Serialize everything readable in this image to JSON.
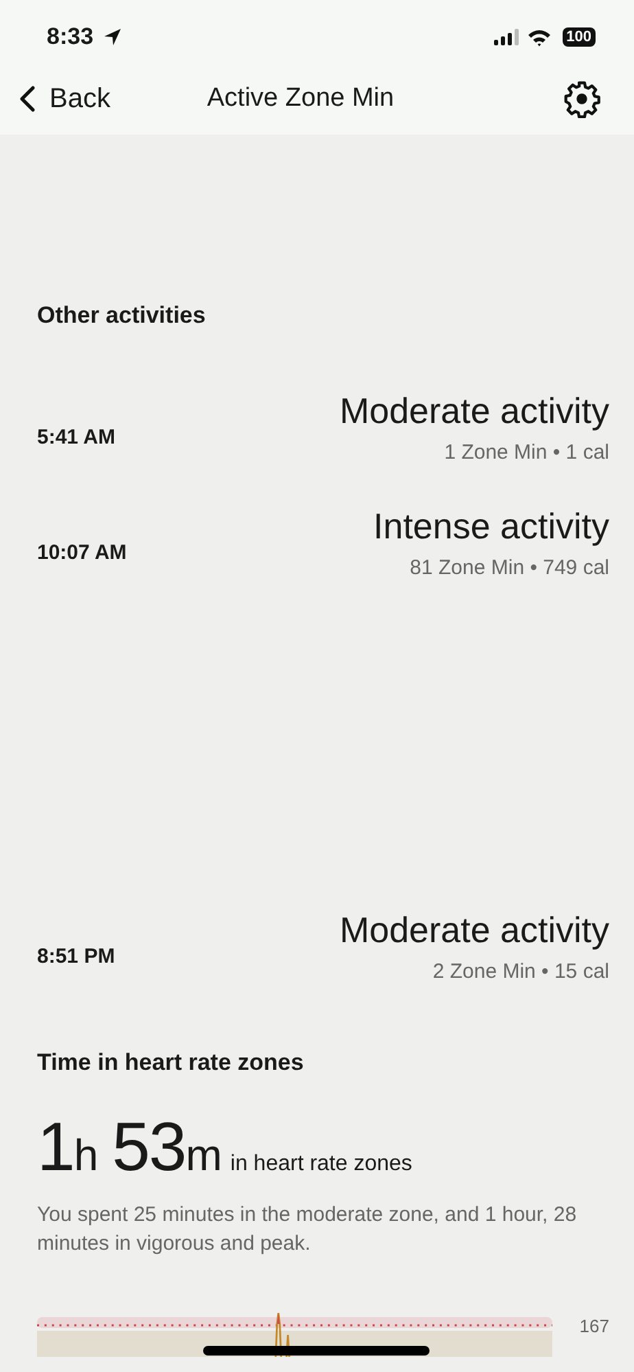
{
  "status_bar": {
    "time": "8:33",
    "battery": "100"
  },
  "nav": {
    "back": "Back",
    "title": "Active Zone Min"
  },
  "other_activities": {
    "heading": "Other activities",
    "items": [
      {
        "time": "5:41 AM",
        "name": "Moderate activity",
        "detail": "1 Zone Min • 1 cal"
      },
      {
        "time": "10:07 AM",
        "name": "Intense activity",
        "detail": "81 Zone Min • 749 cal"
      },
      {
        "time": "8:51 PM",
        "name": "Moderate activity",
        "detail": "2 Zone Min • 15 cal"
      }
    ]
  },
  "heart_rate_zones": {
    "heading": "Time in heart rate zones",
    "hours": "1",
    "hours_unit": "h",
    "minutes": "53",
    "minutes_unit": "m",
    "suffix": "in heart rate zones",
    "summary": "You spent 25 minutes in the moderate zone, and 1 hour, 28 minutes in vigorous and peak.",
    "chart_label": "167"
  }
}
